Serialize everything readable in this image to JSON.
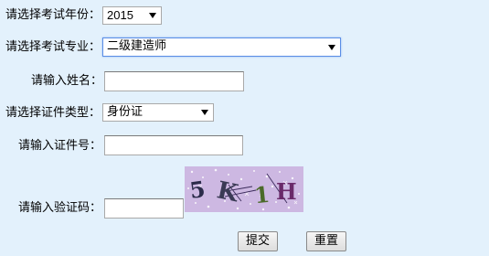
{
  "form": {
    "year": {
      "label": "请选择考试年份：",
      "value": "2015"
    },
    "major": {
      "label": "请选择考试专业：",
      "value": "二级建造师"
    },
    "name": {
      "label": "请输入姓名：",
      "value": ""
    },
    "id_type": {
      "label": "请选择证件类型：",
      "value": "身份证"
    },
    "id_number": {
      "label": "请输入证件号：",
      "value": ""
    },
    "captcha": {
      "label": "请输入验证码：",
      "value": "",
      "image_text": "5K1H"
    },
    "buttons": {
      "submit": "提交",
      "reset": "重置"
    }
  },
  "colors": {
    "page_bg": "#e3f1fc",
    "captcha_bg": "#cdb8e2",
    "focus_border": "#5b8ee6"
  }
}
